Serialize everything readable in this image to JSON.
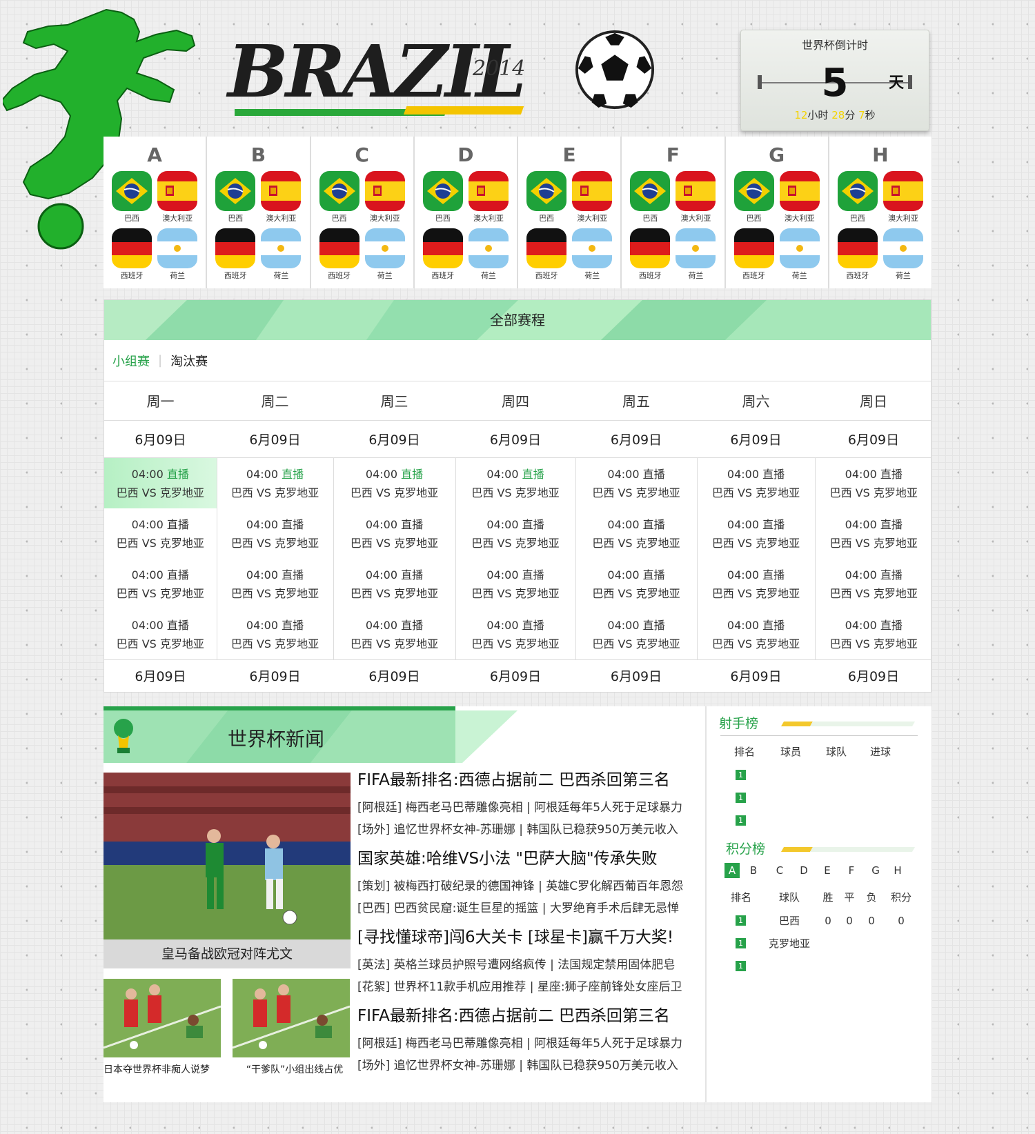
{
  "header": {
    "logo_text": "BRAZIL",
    "logo_year": "2014",
    "countdown": {
      "title": "世界杯倒计时",
      "days": "5",
      "days_label": "天",
      "hours": "12",
      "hours_label": "小时",
      "minutes": "28",
      "minutes_label": "分",
      "seconds": "7",
      "seconds_label": "秒"
    }
  },
  "groups": [
    {
      "name": "A",
      "teams": [
        "巴西",
        "澳大利亚",
        "西班牙",
        "荷兰"
      ]
    },
    {
      "name": "B",
      "teams": [
        "巴西",
        "澳大利亚",
        "西班牙",
        "荷兰"
      ]
    },
    {
      "name": "C",
      "teams": [
        "巴西",
        "澳大利亚",
        "西班牙",
        "荷兰"
      ]
    },
    {
      "name": "D",
      "teams": [
        "巴西",
        "澳大利亚",
        "西班牙",
        "荷兰"
      ]
    },
    {
      "name": "E",
      "teams": [
        "巴西",
        "澳大利亚",
        "西班牙",
        "荷兰"
      ]
    },
    {
      "name": "F",
      "teams": [
        "巴西",
        "澳大利亚",
        "西班牙",
        "荷兰"
      ]
    },
    {
      "name": "G",
      "teams": [
        "巴西",
        "澳大利亚",
        "西班牙",
        "荷兰"
      ]
    },
    {
      "name": "H",
      "teams": [
        "巴西",
        "澳大利亚",
        "西班牙",
        "荷兰"
      ]
    }
  ],
  "flag_icons": [
    "brazil-flag-icon",
    "spain-flag-icon",
    "germany-flag-icon",
    "argentina-flag-icon"
  ],
  "schedule": {
    "title": "全部赛程",
    "tab_group": "小组赛",
    "tab_separator": "|",
    "tab_knockout": "淘汰赛",
    "days": [
      "周一",
      "周二",
      "周三",
      "周四",
      "周五",
      "周六",
      "周日"
    ],
    "dates": [
      "6月09日",
      "6月09日",
      "6月09日",
      "6月09日",
      "6月09日",
      "6月09日",
      "6月09日"
    ],
    "bottom_dates": [
      "6月09日",
      "6月09日",
      "6月09日",
      "6月09日",
      "6月09日",
      "6月09日",
      "6月09日"
    ],
    "game_time": "04:00",
    "game_live": "直播",
    "game_match": "巴西 VS 克罗地亚",
    "games_per_day": 4,
    "green_live_days": [
      0,
      1,
      2,
      3
    ],
    "highlight_day": 0,
    "accent_color": "#27a24a"
  },
  "news": {
    "title": "世界杯新闻",
    "main_caption": "皇马备战欧冠对阵尤文",
    "small_captions": [
      "日本夺世界杯非痴人说梦",
      "“干爹队”小组出线占优"
    ],
    "articles": [
      {
        "title": "FIFA最新排名:西德占据前二 巴西杀回第三名",
        "lines": [
          "[阿根廷] 梅西老马巴蒂雕像亮相 | 阿根廷每年5人死于足球暴力",
          "[场外] 追忆世界杯女神-苏珊娜 | 韩国队已稳获950万美元收入"
        ]
      },
      {
        "title": "国家英雄:哈维VS小法 \"巴萨大脑\"传承失败",
        "lines": [
          "[策划] 被梅西打破纪录的德国神锋 | 英雄C罗化解西葡百年恩怨",
          "[巴西] 巴西贫民窟:诞生巨星的摇篮 | 大罗绝育手术后肆无忌惮"
        ]
      },
      {
        "title": "[寻找懂球帝]闯6大关卡 [球星卡]赢千万大奖!",
        "lines": [
          "[英法] 英格兰球员护照号遭网络疯传 | 法国规定禁用固体肥皂",
          "[花絮] 世界杯11款手机应用推荐 | 星座:狮子座前锋处女座后卫"
        ]
      },
      {
        "title": "FIFA最新排名:西德占据前二 巴西杀回第三名",
        "lines": [
          "[阿根廷] 梅西老马巴蒂雕像亮相 | 阿根廷每年5人死于足球暴力",
          "[场外] 追忆世界杯女神-苏珊娜 | 韩国队已稳获950万美元收入"
        ]
      }
    ]
  },
  "scorers": {
    "title": "射手榜",
    "headers": [
      "排名",
      "球员",
      "球队",
      "进球"
    ],
    "rows": [
      "1",
      "1",
      "1"
    ]
  },
  "standings": {
    "title": "积分榜",
    "group_tabs": [
      "A",
      "B",
      "C",
      "D",
      "E",
      "F",
      "G",
      "H"
    ],
    "headers": [
      "排名",
      "球队",
      "胜",
      "平",
      "负",
      "积分"
    ],
    "rows": [
      {
        "rank": "1",
        "team": "巴西",
        "win": "0",
        "draw": "0",
        "loss": "0",
        "points": "0"
      },
      {
        "rank": "1",
        "team": "克罗地亚",
        "win": "",
        "draw": "",
        "loss": "",
        "points": ""
      },
      {
        "rank": "1",
        "team": "",
        "win": "",
        "draw": "",
        "loss": "",
        "points": ""
      }
    ]
  }
}
